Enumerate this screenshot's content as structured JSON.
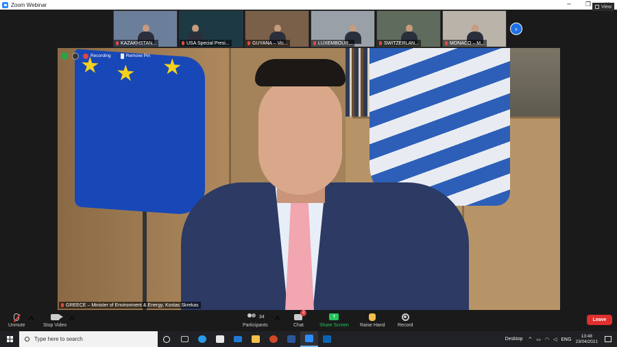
{
  "window": {
    "title": "Zoom Webinar"
  },
  "window_controls": {
    "minimize": "─",
    "restore": "❐",
    "close": "✕"
  },
  "view_button": {
    "label": "View"
  },
  "thumbnails": [
    {
      "name": "KAZAKHSTAN...",
      "bg": "#6b7f9a"
    },
    {
      "name": "USA Special Presi...",
      "bg": "#1d3a44"
    },
    {
      "name": "GUYANA – Vic...",
      "bg": "#7a6048"
    },
    {
      "name": "LUXEMBOUR...",
      "bg": "#9aa0a8"
    },
    {
      "name": "SWITZERLAN...",
      "bg": "#5f6b5c"
    },
    {
      "name": "MONACO – M...",
      "bg": "#b9b3aa"
    }
  ],
  "next_page_icon": "›",
  "main_video": {
    "recording_label": "Recording",
    "remove_pin_label": "Remove Pin",
    "speaker_label": "GREECE – Minister of Environment & Energy, Kostas Skrekas"
  },
  "toolbar": {
    "unmute": "Unmute",
    "stop_video": "Stop Video",
    "participants": "Participants",
    "participants_count": "34",
    "chat": "Chat",
    "chat_badge": "2",
    "share_screen": "Share Screen",
    "share_icon": "↑",
    "raise_hand": "Raise Hand",
    "record": "Record",
    "leave": "Leave",
    "caret": "^"
  },
  "taskbar": {
    "search_placeholder": "Type here to search",
    "desktop_label": "Desktop",
    "language": "ENG",
    "time": "13:48",
    "date": "23/04/2021",
    "tray_caret": "^",
    "apps": [
      {
        "name": "cortana",
        "color": "#ffffff"
      },
      {
        "name": "task-view",
        "color": "#cccccc"
      },
      {
        "name": "edge",
        "color": "#2b9be8"
      },
      {
        "name": "store",
        "color": "#e8e8e8"
      },
      {
        "name": "mail",
        "color": "#1f7ad6"
      },
      {
        "name": "file-explorer",
        "color": "#f3c04a"
      },
      {
        "name": "powerpoint",
        "color": "#d24726"
      },
      {
        "name": "word",
        "color": "#2b579a"
      },
      {
        "name": "zoom",
        "color": "#2d8cff"
      },
      {
        "name": "outlook",
        "color": "#0a64b5"
      }
    ]
  }
}
